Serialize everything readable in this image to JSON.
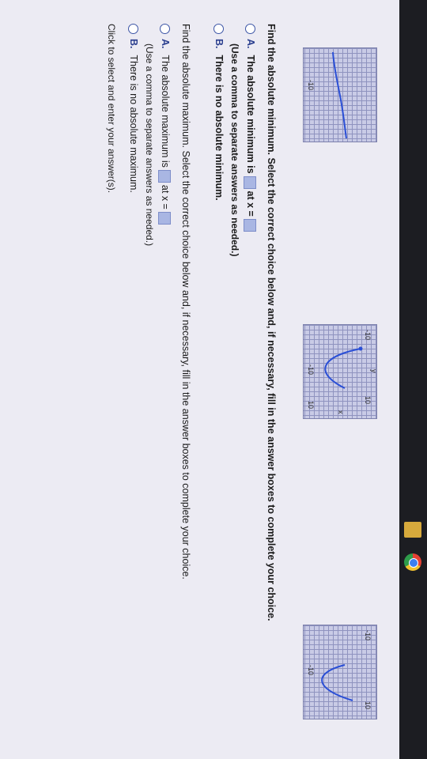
{
  "graphs": {
    "graph1_label": "-10",
    "graph2_labels": [
      "-10",
      "10",
      "-10",
      "10",
      "y",
      "x"
    ],
    "graph3_labels": [
      "-10",
      "10",
      "-10"
    ]
  },
  "min_section": {
    "question": "Find the absolute minimum. Select the correct choice below and, if necessary, fill in the answer boxes to complete your choice.",
    "optA_letter": "A.",
    "optA_text1": "The absolute minimum is",
    "optA_text2": "at x =",
    "optA_hint": "(Use a comma to separate answers as needed.)",
    "optB_letter": "B.",
    "optB_text": "There is no absolute minimum."
  },
  "max_section": {
    "question": "Find the absolute maximum. Select the correct choice below and, if necessary, fill in the answer boxes to complete your choice.",
    "optA_letter": "A.",
    "optA_text1": "The absolute maximum is",
    "optA_text2": "at x =",
    "optA_hint": "(Use a comma to separate answers as needed.)",
    "optB_letter": "B.",
    "optB_text": "There is no absolute maximum."
  },
  "footer": "Click to select and enter your answer(s).",
  "colors": {
    "accent": "#2b3f8f",
    "answer_box": "#a9b6e3",
    "graph_bg": "#c9cbe6"
  }
}
